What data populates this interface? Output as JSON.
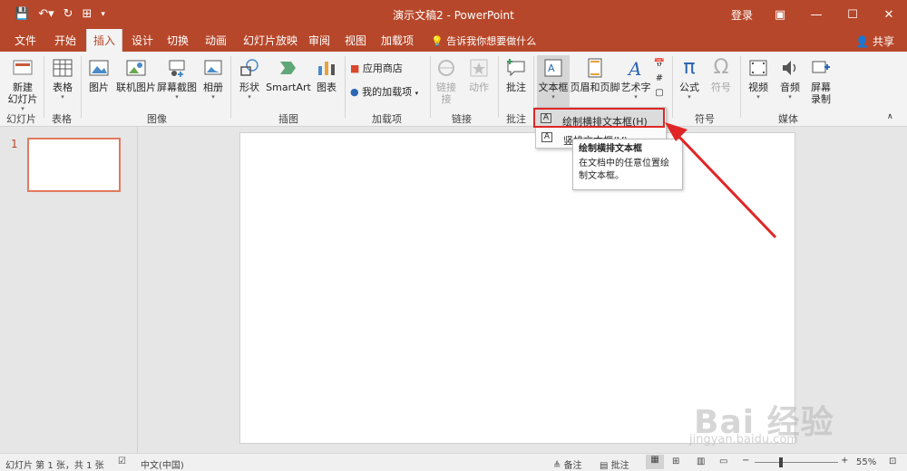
{
  "titlebar": {
    "title": "演示文稿2 - PowerPoint",
    "login": "登录"
  },
  "tabs": [
    "文件",
    "开始",
    "插入",
    "设计",
    "切换",
    "动画",
    "幻灯片放映",
    "审阅",
    "视图",
    "加载项"
  ],
  "active_tab": "插入",
  "tellme": "告诉我你想要做什么",
  "share": "共享",
  "ribbon": {
    "new_slide": "新建\n幻灯片",
    "table": "表格",
    "picture": "图片",
    "online_picture": "联机图片",
    "screenshot": "屏幕截图",
    "album": "相册",
    "shapes": "形状",
    "smartart": "SmartArt",
    "chart": "图表",
    "store": "应用商店",
    "my_addins": "我的加载项",
    "link": "链接",
    "link_sub": "接",
    "action": "动作",
    "comment": "批注",
    "textbox": "文本框",
    "header_footer": "页眉和页脚",
    "wordart": "艺术字",
    "equation": "公式",
    "symbol": "符号",
    "video": "视频",
    "audio": "音频",
    "screen_record": "屏幕\n录制",
    "groups": {
      "slides": "幻灯片",
      "tables": "表格",
      "images": "图像",
      "illustrations": "插图",
      "addins": "加载项",
      "links": "链接",
      "comments": "批注",
      "symbols": "符号",
      "media": "媒体"
    }
  },
  "dropdown": {
    "item1": "绘制横排文本框(H)",
    "item2": "竖排文本框(V)"
  },
  "tooltip": {
    "title": "绘制横排文本框",
    "body": "在文档中的任意位置绘制文本框。"
  },
  "slides": {
    "number": "1"
  },
  "status": {
    "slide_info": "幻灯片 第 1 张，共 1 张",
    "language": "中文(中国)",
    "notes": "备注",
    "comments": "批注",
    "zoom": "55%"
  },
  "watermark": {
    "main": "Bai 经验",
    "sub": "jingyan.baidu.com"
  },
  "colors": {
    "accent": "#b7472a",
    "highlight": "#e02626"
  }
}
